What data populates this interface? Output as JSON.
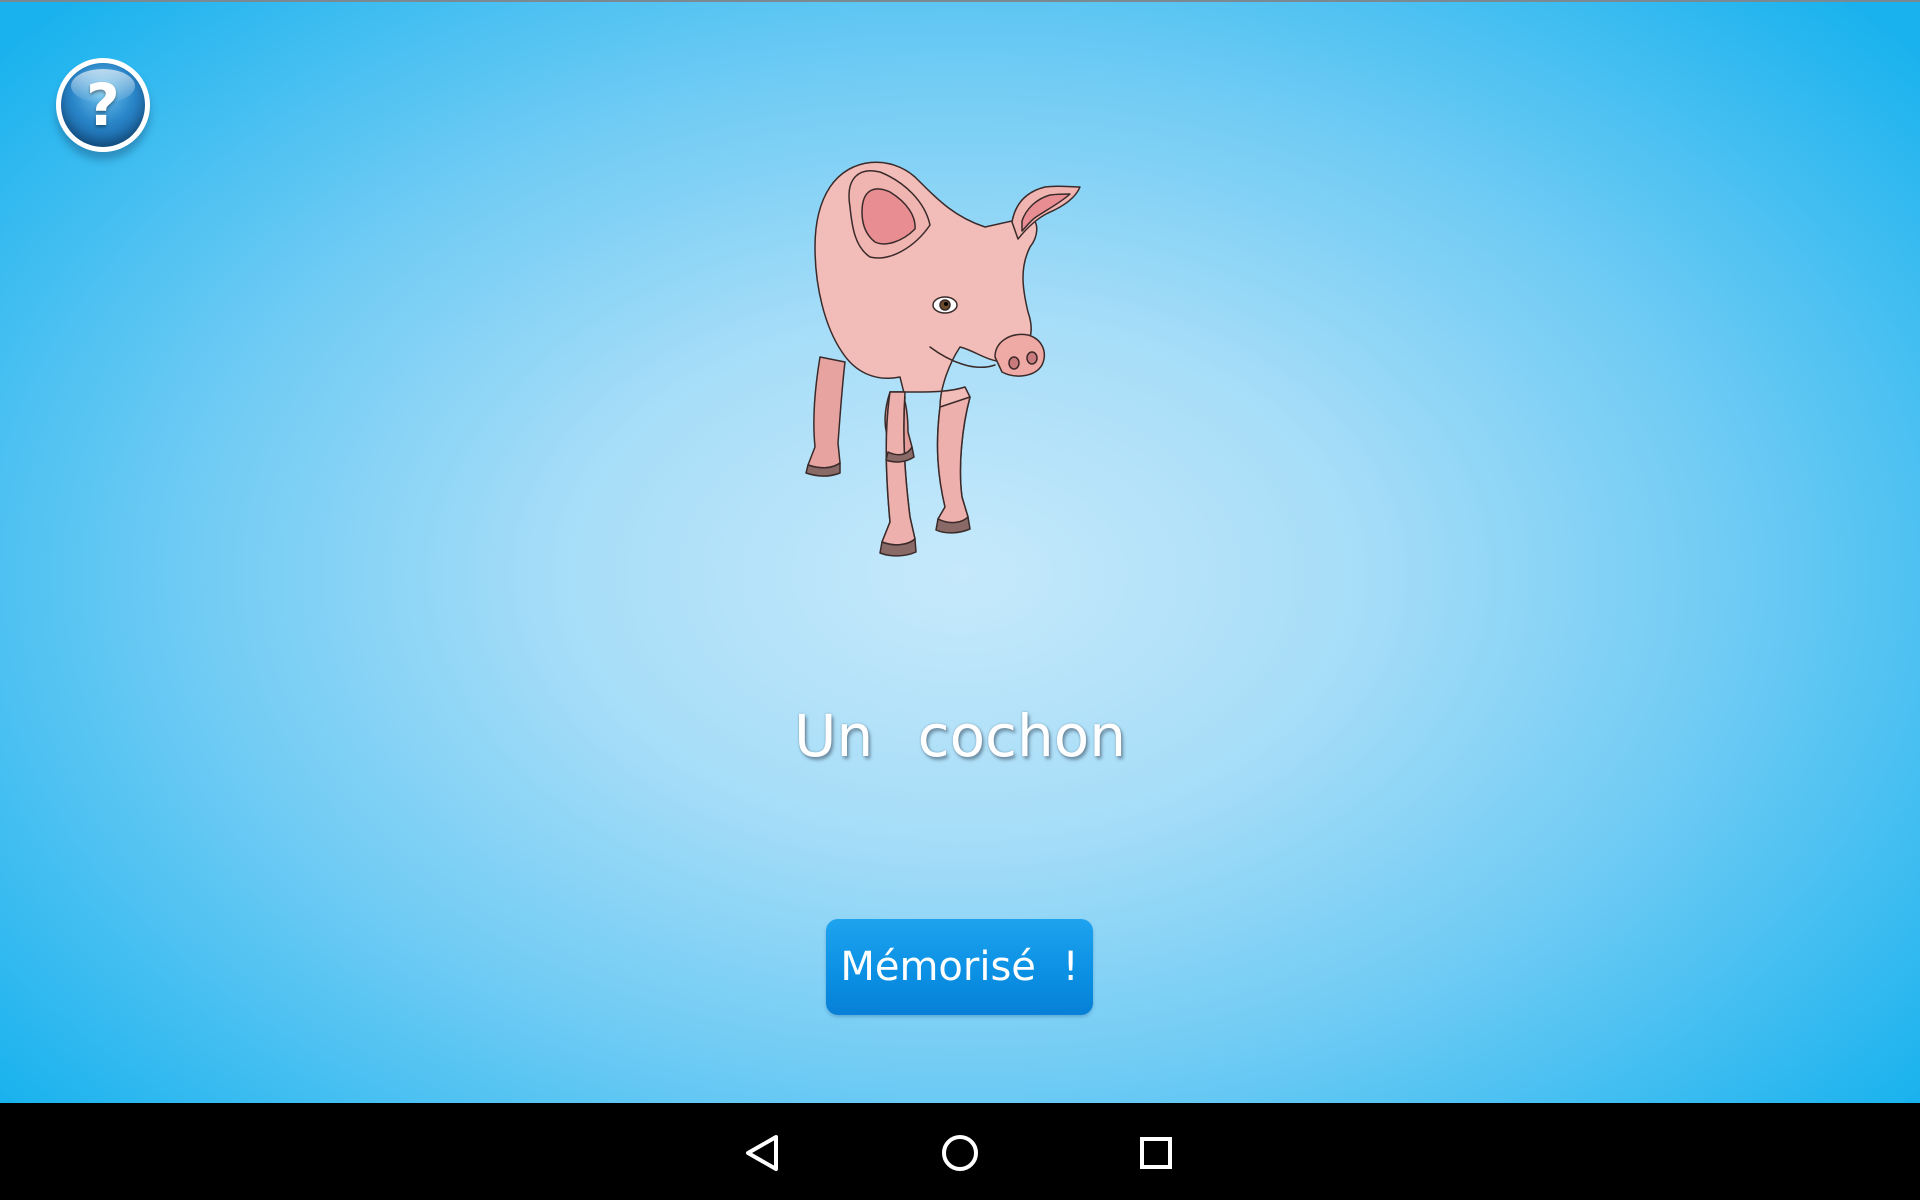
{
  "help": {
    "symbol": "?",
    "icon": "question-mark-icon"
  },
  "card": {
    "image": "pig-illustration",
    "word": "Un cochon"
  },
  "actions": {
    "memorised_label": "Mémorisé !"
  },
  "navigation": {
    "icons": [
      "back-triangle-icon",
      "home-circle-icon",
      "recents-square-icon"
    ]
  },
  "colors": {
    "background_center": "#c6e9fb",
    "background_edge": "#19b2ee",
    "button": "#0a8fe3",
    "nav_bar": "#000000"
  }
}
